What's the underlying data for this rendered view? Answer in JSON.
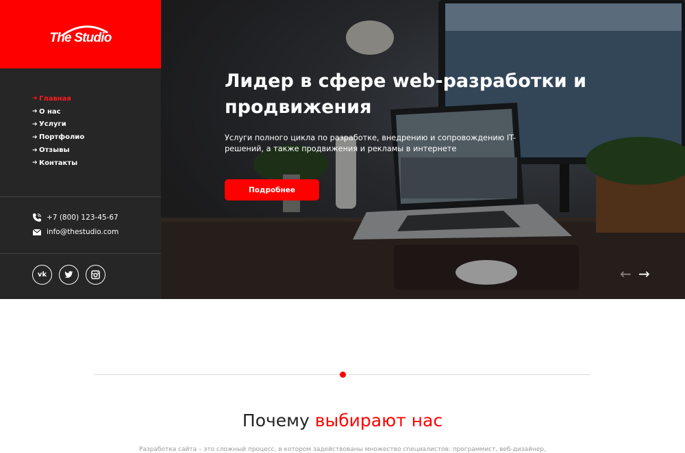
{
  "brand": {
    "logo_text": "The Studio",
    "accent_color": "#ff0000",
    "sidebar_color": "#262626"
  },
  "nav": {
    "items": [
      {
        "label": "Главная",
        "active": true
      },
      {
        "label": "О нас",
        "active": false
      },
      {
        "label": "Услуги",
        "active": false
      },
      {
        "label": "Портфолио",
        "active": false
      },
      {
        "label": "Отзывы",
        "active": false
      },
      {
        "label": "Контакты",
        "active": false
      }
    ]
  },
  "contacts": {
    "phone": "+7 (800) 123-45-67",
    "email": "info@thestudio.com"
  },
  "socials": [
    {
      "name": "vk",
      "glyph": "vk",
      "icon": "vk-icon"
    },
    {
      "name": "twitter",
      "icon": "twitter-icon"
    },
    {
      "name": "instagram",
      "icon": "instagram-icon"
    }
  ],
  "hero": {
    "title": "Лидер в сфере web-разработки и продвижения",
    "subtitle": "Услуги полного цикла по разработке, внедрению и сопровождению IT-решений, а также продвижения и рекламы в интернете",
    "button_label": "Подробнее",
    "prev_arrow": "←",
    "next_arrow": "→"
  },
  "why": {
    "title_plain": "Почему ",
    "title_accent": "выбирают нас",
    "text": "Разработка сайта – это сложный процесс, в котором задействованы множество специалистов: программист, веб-дизайнер,"
  }
}
